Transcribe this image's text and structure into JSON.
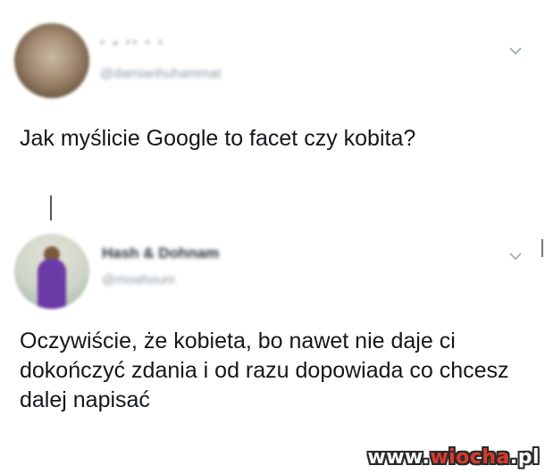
{
  "tweets": [
    {
      "name": "· - ·· · ·",
      "handle": "@damianhuhammat",
      "text": "Jak myślicie Google to facet czy kobita?",
      "menu_icon": "chevron-down-icon"
    },
    {
      "name": "Hash & Dohnam",
      "handle": "@moahoum",
      "text": "Oczywiście, że kobieta, bo nawet nie daje ci dokończyć zdania i od razu dopowiada co chcesz dalej napisać",
      "menu_icon": "chevron-down-icon"
    }
  ],
  "watermark": {
    "prefix": "www.",
    "brand": "wiocha",
    "suffix": ".pl"
  },
  "colors": {
    "text": "#14171a",
    "muted": "#8e9aa4",
    "watermark_brand": "#d93a2b"
  }
}
